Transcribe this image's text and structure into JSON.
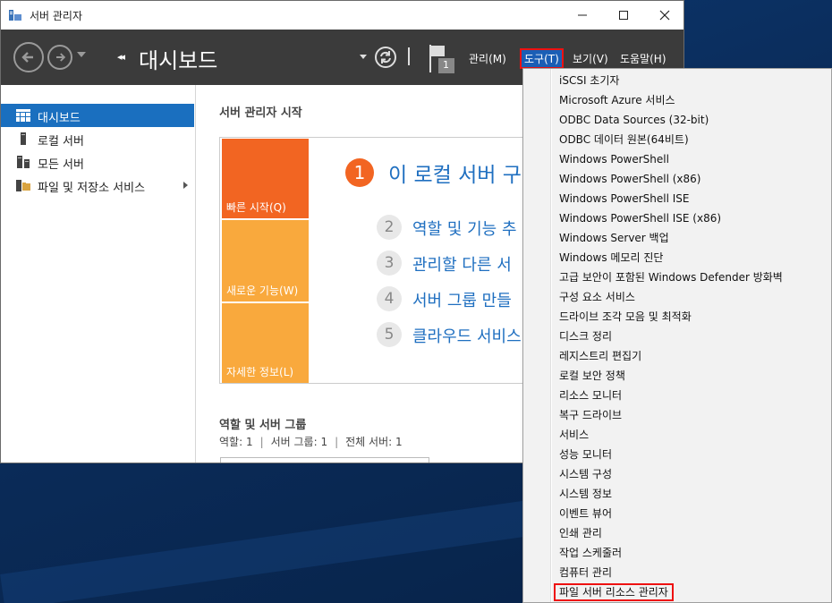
{
  "window": {
    "title": "서버 관리자"
  },
  "toolbar": {
    "breadcrumb_arrows": "◂◂",
    "page_title": "대시보드",
    "flag_count": "1",
    "menus": {
      "manage": "관리(M)",
      "tools": "도구(T)",
      "view": "보기(V)",
      "help": "도움말(H)"
    }
  },
  "sidebar": {
    "items": [
      {
        "label": "대시보드",
        "icon": "dashboard-icon",
        "active": true
      },
      {
        "label": "로컬 서버",
        "icon": "server-icon"
      },
      {
        "label": "모든 서버",
        "icon": "servers-icon"
      },
      {
        "label": "파일 및 저장소 서비스",
        "icon": "file-storage-icon",
        "has_submenu": true
      }
    ]
  },
  "main": {
    "heading": "서버 관리자 시작",
    "tiles": [
      "빠른 시작(Q)",
      "새로운 기능(W)",
      "자세한 정보(L)"
    ],
    "steps": [
      {
        "num": "1",
        "text": "이 로컬 서버 구"
      },
      {
        "num": "2",
        "text": "역할 및 기능 추"
      },
      {
        "num": "3",
        "text": "관리할 다른 서"
      },
      {
        "num": "4",
        "text": "서버 그룹 만들"
      },
      {
        "num": "5",
        "text": "클라우드 서비스"
      }
    ],
    "roles_heading": "역할 및 서버 그룹",
    "roles_stats": {
      "roles": "역할: 1",
      "groups": "서버 그룹: 1",
      "total": "전체 서버: 1",
      "sep": "|"
    }
  },
  "tools_menu": {
    "items": [
      "iSCSI 초기자",
      "Microsoft Azure 서비스",
      "ODBC Data Sources (32-bit)",
      "ODBC 데이터 원본(64비트)",
      "Windows PowerShell",
      "Windows PowerShell (x86)",
      "Windows PowerShell ISE",
      "Windows PowerShell ISE (x86)",
      "Windows Server 백업",
      "Windows 메모리 진단",
      "고급 보안이 포함된 Windows Defender 방화벽",
      "구성 요소 서비스",
      "드라이브 조각 모음 및 최적화",
      "디스크 정리",
      "레지스트리 편집기",
      "로컬 보안 정책",
      "리소스 모니터",
      "복구 드라이브",
      "서비스",
      "성능 모니터",
      "시스템 구성",
      "시스템 정보",
      "이벤트 뷰어",
      "인쇄 관리",
      "작업 스케줄러",
      "컴퓨터 관리",
      "파일 서버 리소스 관리자"
    ],
    "highlighted_index": 26
  },
  "colors": {
    "accent": "#1a6fbf",
    "tile_primary": "#f26522",
    "tile_secondary": "#f9a93d",
    "highlight_border": "#ee1111"
  }
}
